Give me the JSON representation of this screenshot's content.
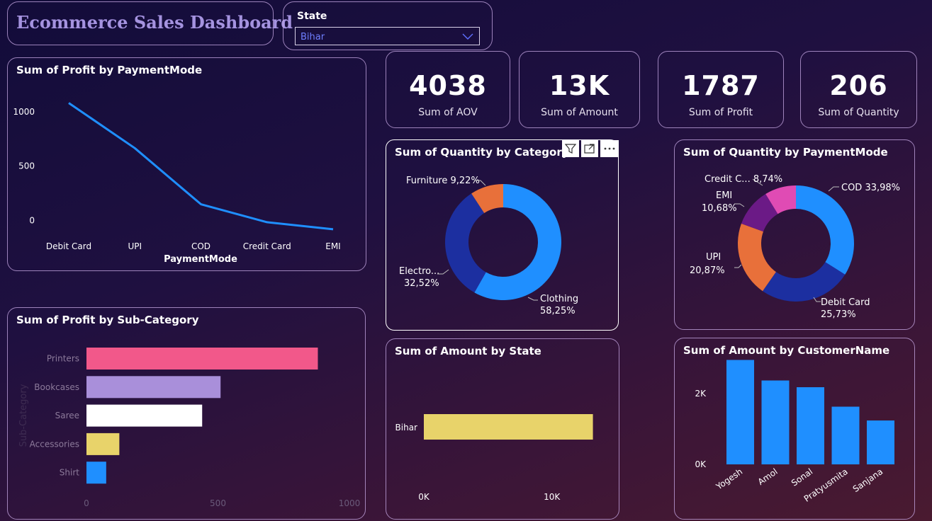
{
  "header": {
    "title": "Ecommerce Sales Dashboard"
  },
  "filter": {
    "label": "State",
    "selected": "Bihar",
    "icon": "chevron-down-icon"
  },
  "kpis": [
    {
      "value": "4038",
      "label": "Sum of AOV"
    },
    {
      "value": "13K",
      "label": "Sum of Amount"
    },
    {
      "value": "1787",
      "label": "Sum of Profit"
    },
    {
      "value": "206",
      "label": "Sum of Quantity"
    }
  ],
  "visual_header_icons": [
    "filter-icon",
    "focus-mode-icon",
    "more-options-icon"
  ],
  "chart_data": [
    {
      "id": "profit_by_paymentmode",
      "type": "line",
      "title": "Sum of Profit by PaymentMode",
      "xlabel": "PaymentMode",
      "ylabel": "",
      "categories": [
        "Debit Card",
        "UPI",
        "COD",
        "Credit Card",
        "EMI"
      ],
      "values": [
        1080,
        665,
        150,
        -15,
        -80
      ],
      "yticks": [
        "1000",
        "500",
        "0"
      ],
      "ytick_values": [
        1000,
        500,
        0
      ],
      "ylim": [
        -100,
        1200
      ],
      "color": "#1f8fff"
    },
    {
      "id": "profit_by_subcategory",
      "type": "bar",
      "orientation": "horizontal",
      "title": "Sum of Profit by Sub-Category",
      "ylabel": "Sub-Category",
      "categories": [
        "Printers",
        "Bookcases",
        "Saree",
        "Accessories",
        "Shirt"
      ],
      "values": [
        880,
        510,
        440,
        125,
        75
      ],
      "colors": [
        "#f2588a",
        "#a98fda",
        "#ffffff",
        "#e8d36a",
        "#1f8fff"
      ],
      "xticks": [
        "0",
        "500",
        "1000"
      ],
      "xtick_values": [
        0,
        500,
        1000
      ],
      "xlim": [
        0,
        1000
      ]
    },
    {
      "id": "quantity_by_category",
      "type": "pie",
      "title": "Sum of Quantity by Category",
      "slices": [
        {
          "name": "Clothing",
          "pct_label": "58,25%",
          "value": 58.25,
          "color": "#1f8fff"
        },
        {
          "name": "Electro...",
          "pct_label": "32,52%",
          "value": 32.52,
          "color": "#1c2fa0"
        },
        {
          "name": "Furniture",
          "pct_label": "9,22%",
          "value": 9.22,
          "color": "#e8703a"
        }
      ]
    },
    {
      "id": "quantity_by_paymentmode",
      "type": "pie",
      "title": "Sum of Quantity by PaymentMode",
      "slices": [
        {
          "name": "COD",
          "pct_label": "33,98%",
          "value": 33.98,
          "color": "#1f8fff"
        },
        {
          "name": "Debit Card",
          "pct_label": "25,73%",
          "value": 25.73,
          "color": "#1c2fa0"
        },
        {
          "name": "UPI",
          "pct_label": "20,87%",
          "value": 20.87,
          "color": "#e8703a"
        },
        {
          "name": "EMI",
          "pct_label": "10,68%",
          "value": 10.68,
          "color": "#6b1a86"
        },
        {
          "name": "Credit C...",
          "pct_label": "8,74%",
          "value": 8.74,
          "color": "#e04bb4"
        }
      ]
    },
    {
      "id": "amount_by_state",
      "type": "bar",
      "orientation": "horizontal",
      "title": "Sum of Amount by State",
      "categories": [
        "Bihar"
      ],
      "values": [
        13200
      ],
      "color": "#e8d36a",
      "xticks": [
        "0K",
        "10K"
      ],
      "xtick_values": [
        0,
        10000
      ],
      "xlim": [
        0,
        13500
      ]
    },
    {
      "id": "amount_by_customername",
      "type": "bar",
      "title": "Sum of Amount by CustomerName",
      "categories": [
        "Yogesh",
        "Amol",
        "Sonal",
        "Pratyusmita",
        "Sanjana"
      ],
      "values": [
        2950,
        2370,
        2180,
        1630,
        1240
      ],
      "color": "#1f8fff",
      "yticks": [
        "2K",
        "0K"
      ],
      "ytick_values": [
        2000,
        0
      ],
      "ylim": [
        0,
        3000
      ]
    }
  ]
}
